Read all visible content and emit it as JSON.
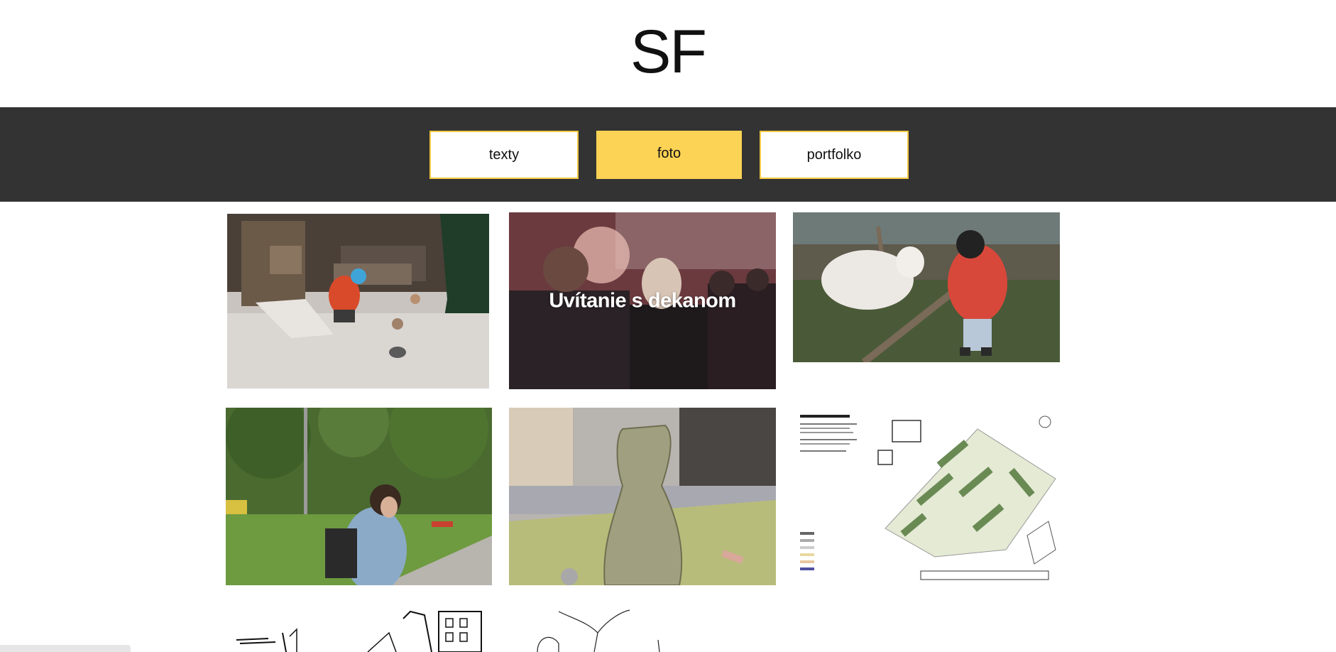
{
  "site": {
    "logo_text": "SF"
  },
  "nav": {
    "items": [
      {
        "label": "texty",
        "active": false
      },
      {
        "label": "foto",
        "active": true
      },
      {
        "label": "portfolko",
        "active": false
      }
    ],
    "accent_color": "#fdd355",
    "bar_color": "#333333"
  },
  "gallery": {
    "items": [
      {
        "name": "photo-chickens-coop",
        "caption": ""
      },
      {
        "name": "photo-dean-welcome",
        "caption": "Uvítanie s dekanom"
      },
      {
        "name": "photo-goat-fence",
        "caption": ""
      },
      {
        "name": "photo-park-girl",
        "caption": ""
      },
      {
        "name": "photo-clay-sculpture",
        "caption": ""
      },
      {
        "name": "plan-housing-site",
        "caption": ""
      },
      {
        "name": "sketch-street",
        "caption": ""
      },
      {
        "name": "sketch-lines",
        "caption": ""
      }
    ]
  }
}
